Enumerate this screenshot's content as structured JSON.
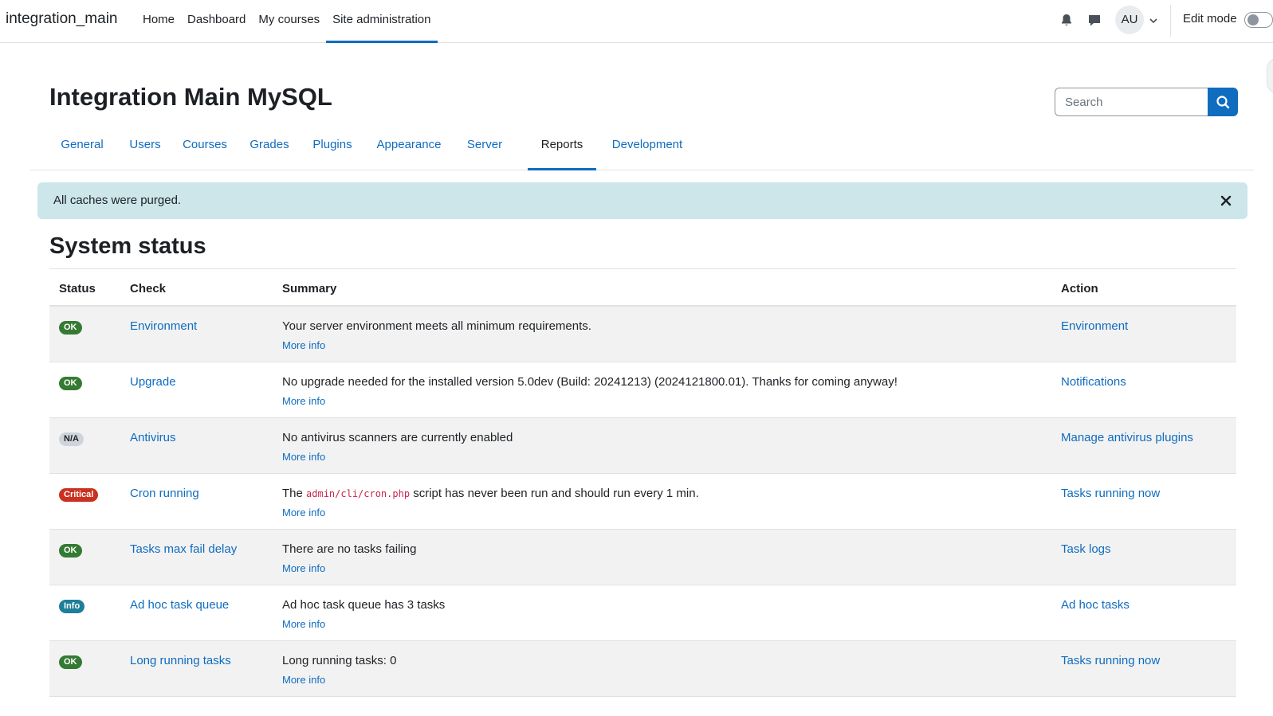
{
  "navbar": {
    "brand": "integration_main",
    "items": [
      {
        "label": "Home"
      },
      {
        "label": "Dashboard"
      },
      {
        "label": "My courses"
      },
      {
        "label": "Site administration",
        "active": true
      }
    ],
    "avatar_initials": "AU",
    "edit_mode_label": "Edit mode",
    "edit_mode_on": false
  },
  "header": {
    "title": "Integration Main MySQL",
    "search_placeholder": "Search"
  },
  "tabs": [
    {
      "label": "General"
    },
    {
      "label": "Users"
    },
    {
      "label": "Courses"
    },
    {
      "label": "Grades"
    },
    {
      "label": "Plugins"
    },
    {
      "label": "Appearance"
    },
    {
      "label": "Server"
    },
    {
      "label": "Reports",
      "active": true
    },
    {
      "label": "Development"
    }
  ],
  "alert": {
    "message": "All caches were purged."
  },
  "section": {
    "title": "System status"
  },
  "table": {
    "headers": {
      "status": "Status",
      "check": "Check",
      "summary": "Summary",
      "action": "Action"
    },
    "more_info_label": "More info",
    "rows": [
      {
        "status": "OK",
        "check": "Environment",
        "summary": "Your server environment meets all minimum requirements.",
        "action": "Environment"
      },
      {
        "status": "OK",
        "check": "Upgrade",
        "summary": "No upgrade needed for the installed version 5.0dev (Build: 20241213) (2024121800.01). Thanks for coming anyway!",
        "action": "Notifications"
      },
      {
        "status": "N/A",
        "check": "Antivirus",
        "summary": "No antivirus scanners are currently enabled",
        "action": "Manage antivirus plugins"
      },
      {
        "status": "Critical",
        "check": "Cron running",
        "summary_pre": "The ",
        "summary_code": "admin/cli/cron.php",
        "summary_post": " script has never been run and should run every 1 min.",
        "action": "Tasks running now"
      },
      {
        "status": "OK",
        "check": "Tasks max fail delay",
        "summary": "There are no tasks failing",
        "action": "Task logs"
      },
      {
        "status": "Info",
        "check": "Ad hoc task queue",
        "summary": "Ad hoc task queue has 3 tasks",
        "action": "Ad hoc tasks"
      },
      {
        "status": "OK",
        "check": "Long running tasks",
        "summary": "Long running tasks: 0",
        "action": "Tasks running now"
      }
    ]
  },
  "colors": {
    "primary": "#0f6cbf",
    "ok": "#357a32",
    "critical": "#ca3120",
    "info": "#1f7e9a",
    "alert_bg": "#cce6ea"
  }
}
